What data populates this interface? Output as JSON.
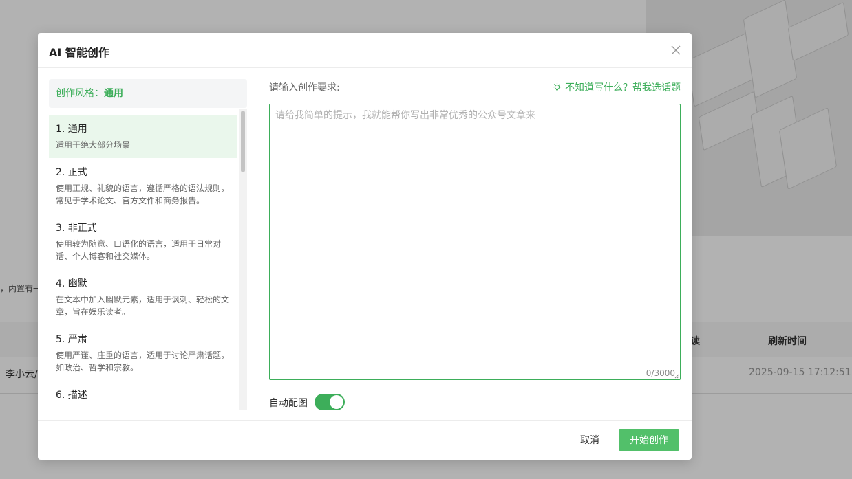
{
  "background": {
    "intro_fragment": "，内置有一",
    "table": {
      "col_reads": "读",
      "col_refresh": "刷新时间",
      "row_author": "李小云/",
      "row_refresh_time": "2025-09-15 17:12:51"
    }
  },
  "modal": {
    "title": "AI 智能创作",
    "style_header": {
      "label": "创作风格：",
      "value": "通用"
    },
    "styles": [
      {
        "name": "1. 通用",
        "desc": "适用于绝大部分场景"
      },
      {
        "name": "2. 正式",
        "desc": "使用正规、礼貌的语言，遵循严格的语法规则，常见于学术论文、官方文件和商务报告。"
      },
      {
        "name": "3. 非正式",
        "desc": "使用较为随意、口语化的语言，适用于日常对话、个人博客和社交媒体。"
      },
      {
        "name": "4. 幽默",
        "desc": "在文本中加入幽默元素，适用于讽刺、轻松的文章，旨在娱乐读者。"
      },
      {
        "name": "5. 严肃",
        "desc": "使用严谨、庄重的语言，适用于讨论严肃话题，如政治、哲学和宗教。"
      },
      {
        "name": "6. 描述",
        "desc": ""
      }
    ],
    "request_label": "请输入创作要求:",
    "help_link": "不知道写什么？帮我选话题",
    "textarea": {
      "value": "",
      "placeholder": "请给我简单的提示，我就能帮你写出非常优秀的公众号文章来"
    },
    "char_count": "0/3000",
    "auto_image_label": "自动配图",
    "auto_image_on": true,
    "cancel_label": "取消",
    "start_label": "开始创作"
  },
  "colors": {
    "accent": "#3dae5a",
    "button": "#52c06a",
    "active_bg": "#eaf7ec"
  }
}
